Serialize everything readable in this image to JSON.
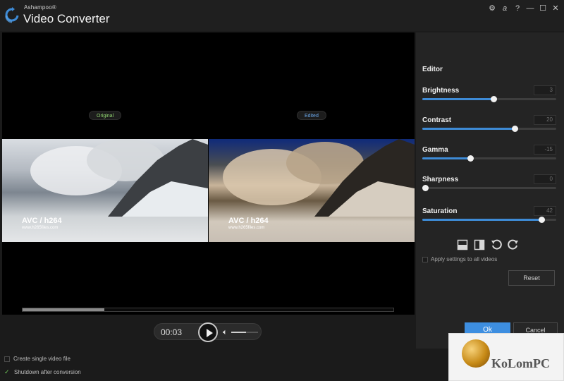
{
  "titlebar": {
    "brand": "Ashampoo®",
    "title": "Video Converter",
    "controls": [
      {
        "name": "settings-icon",
        "glyph": "⚙"
      },
      {
        "name": "account-icon",
        "glyph": "a"
      },
      {
        "name": "help-icon",
        "glyph": "?"
      },
      {
        "name": "minimize-icon",
        "glyph": "—"
      },
      {
        "name": "maximize-icon",
        "glyph": "☐"
      },
      {
        "name": "close-icon",
        "glyph": "✕"
      }
    ]
  },
  "preview": {
    "original_label": "Original",
    "edited_label": "Edited",
    "video_title": "AVC / h264",
    "video_subtitle": "www.h265files.com",
    "progress": 0.22
  },
  "player": {
    "time": "00:03",
    "volume": 0.55
  },
  "editor": {
    "title": "Editor",
    "settings": [
      {
        "id": "brightness",
        "label": "Brightness",
        "value": "3",
        "fill": 0.53
      },
      {
        "id": "contrast",
        "label": "Contrast",
        "value": "20",
        "fill": 0.69
      },
      {
        "id": "gamma",
        "label": "Gamma",
        "value": "-15",
        "fill": 0.36
      },
      {
        "id": "sharpness",
        "label": "Sharpness",
        "value": "0",
        "fill": 0.02
      },
      {
        "id": "saturation",
        "label": "Saturation",
        "value": "42",
        "fill": 0.89
      }
    ],
    "tools": [
      "split-horizontal-icon",
      "split-vertical-icon",
      "rotate-left-icon",
      "rotate-right-icon"
    ],
    "apply_all_label": "Apply settings to all videos",
    "reset_label": "Reset"
  },
  "actions": {
    "ok_label": "Ok",
    "cancel_label": "Cancel"
  },
  "options": {
    "single_file_label": "Create single video file",
    "shutdown_label": "Shutdown after conversion"
  },
  "watermark": {
    "text": "KoLomPC"
  },
  "colors": {
    "accent": "#3e8bd6",
    "original_label": "#8fd26f",
    "edited_label": "#6aa6e8",
    "checkmark": "#6fc85a"
  }
}
